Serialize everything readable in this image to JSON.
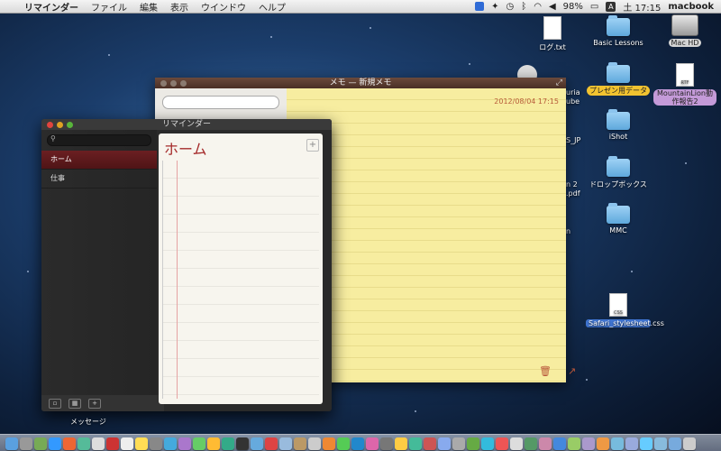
{
  "menubar": {
    "app_name": "リマインダー",
    "menus": [
      "ファイル",
      "編集",
      "表示",
      "ウインドウ",
      "ヘルプ"
    ],
    "battery": "98%",
    "ime": "A",
    "clock": "土 17:15",
    "user": "macbook"
  },
  "desktop": {
    "icons": [
      {
        "label": "ログ.txt"
      },
      {
        "label": "Basic Lessons"
      },
      {
        "label": "Mac HD"
      },
      {
        "label": "プレゼン用データ"
      },
      {
        "label": "MountainLion動作報告2"
      },
      {
        "label": "iShot"
      },
      {
        "label": "ドロップボックス"
      },
      {
        "label": "MMC"
      },
      {
        "label": "Safari_stylesheet.css"
      }
    ],
    "partial_labels": [
      "uria",
      "ube",
      "S_JP",
      "n 2",
      ".pdf",
      "n"
    ]
  },
  "notes": {
    "title": "メモ — 新規メモ",
    "date": "2012/08/04 17:15"
  },
  "reminders": {
    "title": "リマインダー",
    "lists": [
      {
        "label": "ホーム",
        "selected": true
      },
      {
        "label": "仕事",
        "selected": false
      }
    ],
    "heading": "ホーム",
    "add_label": "+"
  },
  "dock_label": "メッセージ"
}
